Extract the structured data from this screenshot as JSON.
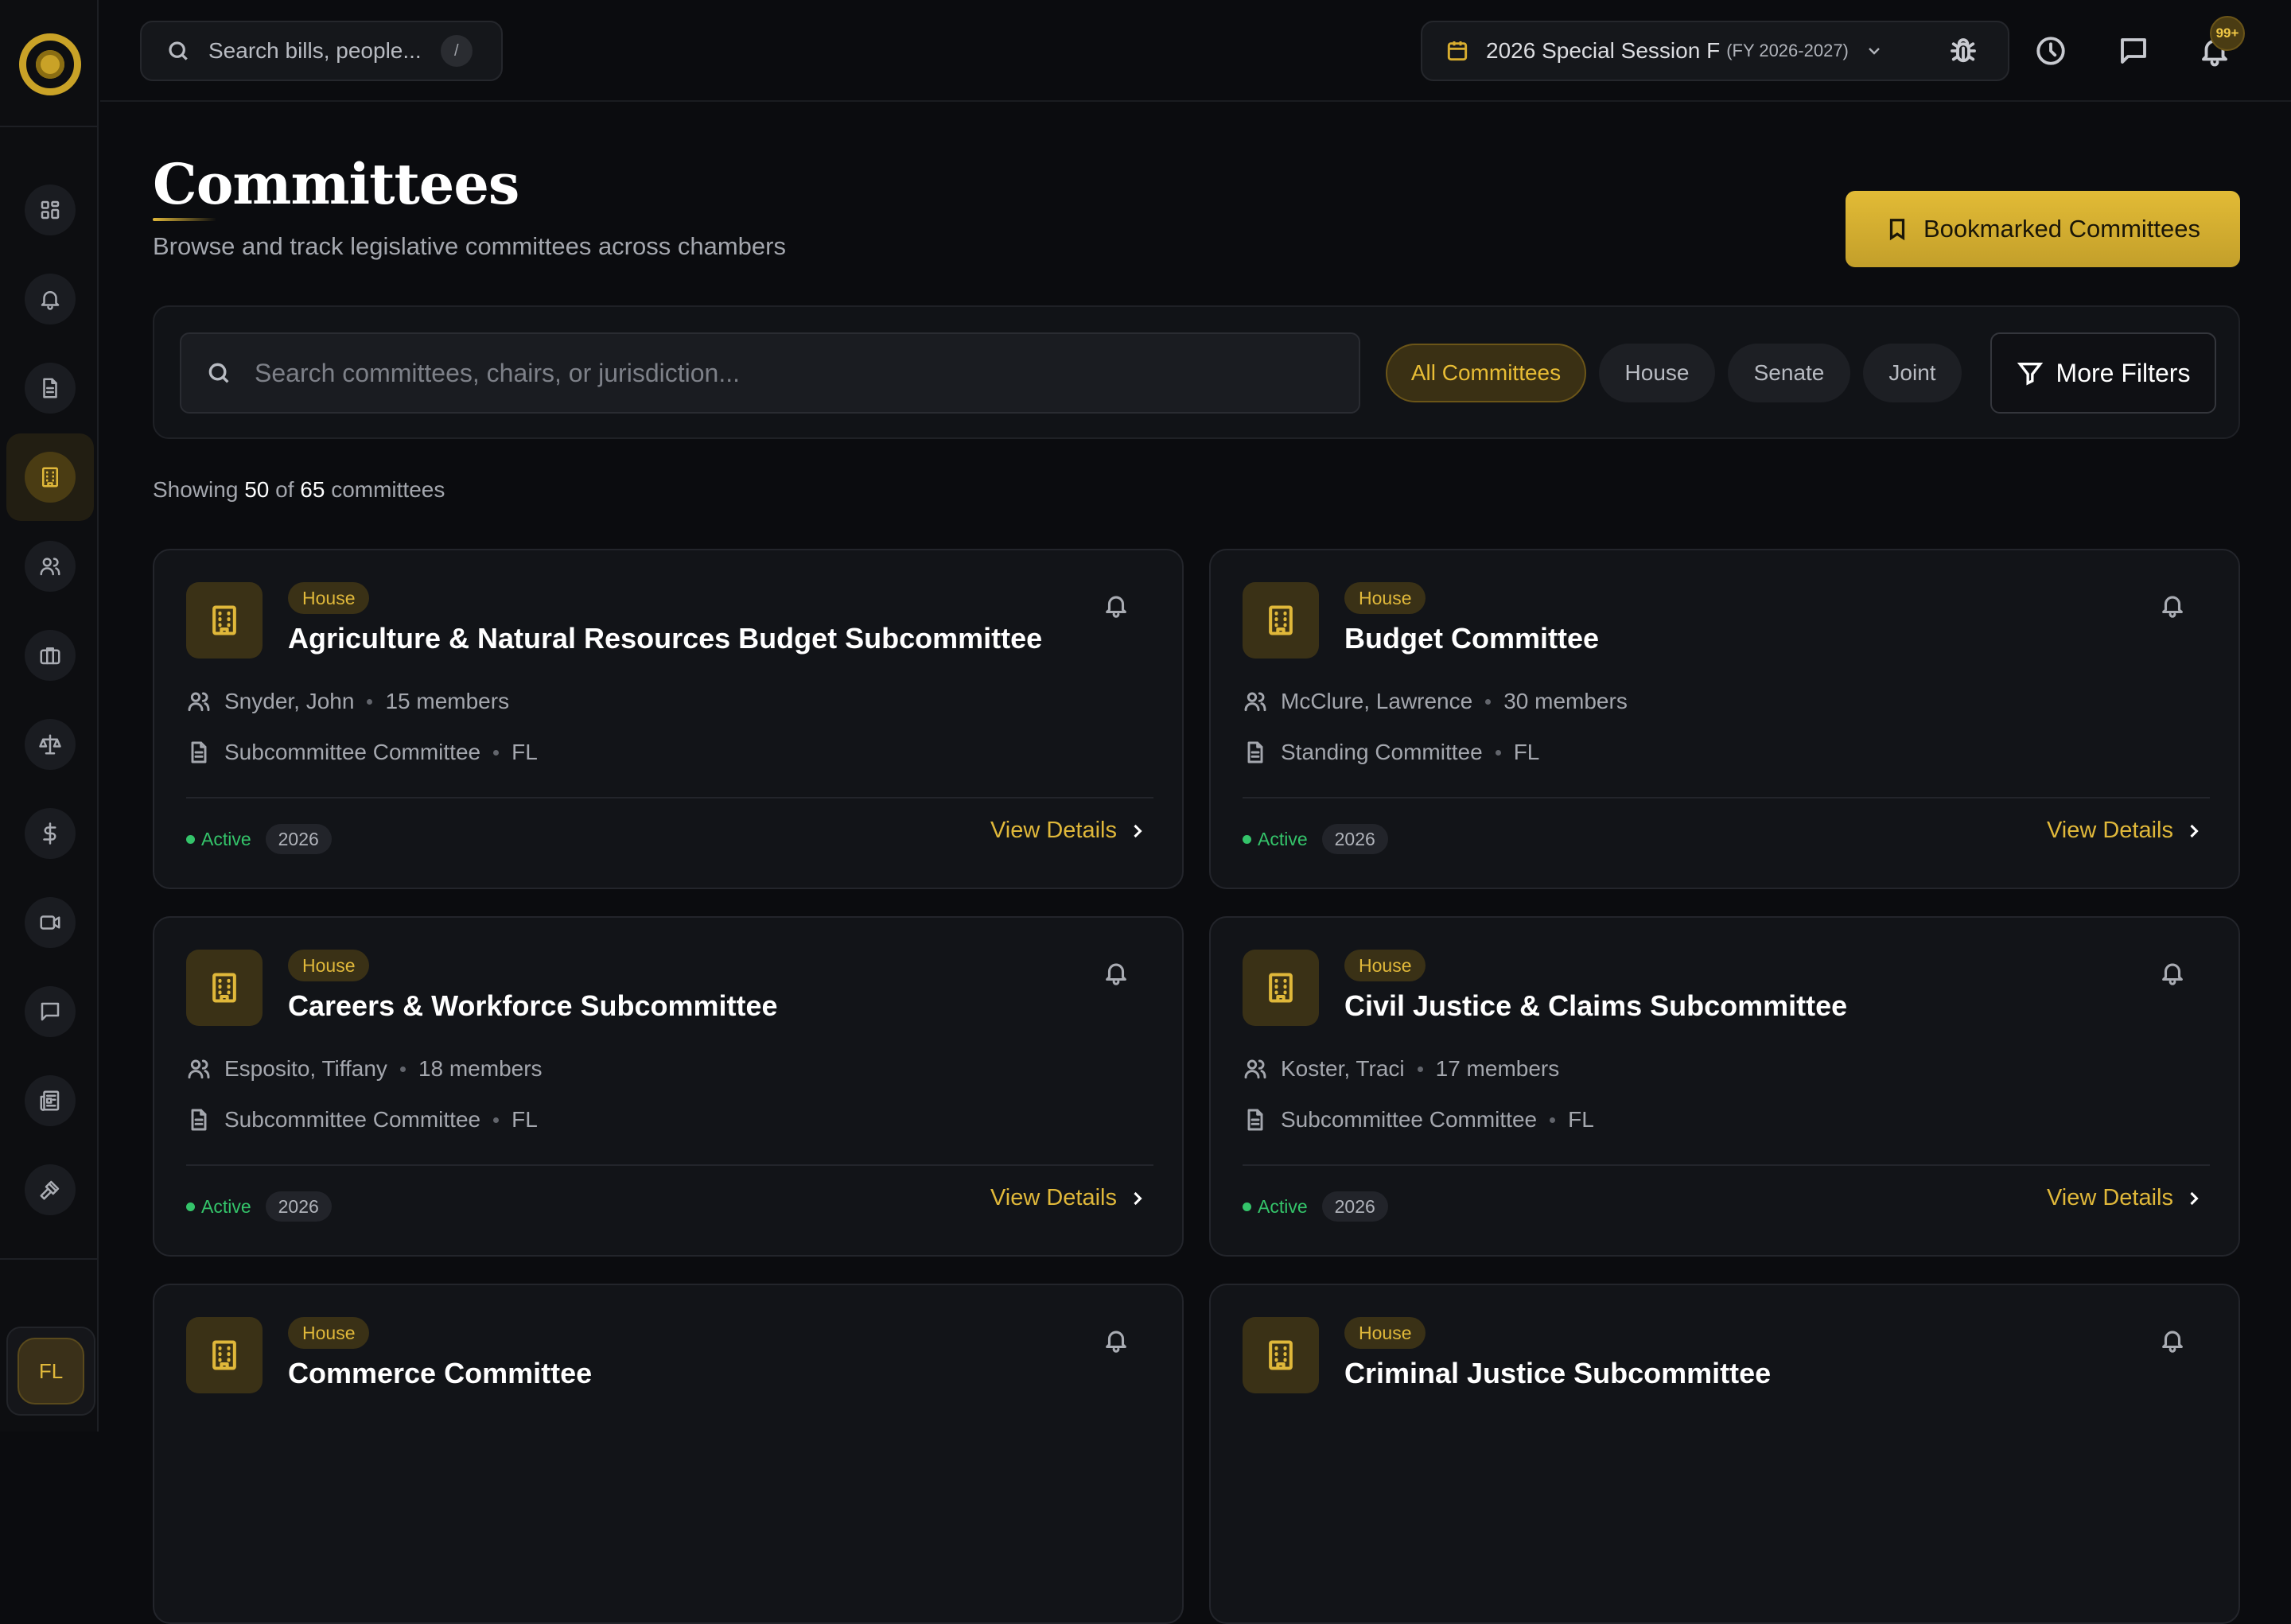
{
  "top_search": {
    "placeholder": "Search bills, people...",
    "shortcut": "/"
  },
  "session": {
    "label": "2026 Special Session F",
    "fy": "(FY 2026-2027)"
  },
  "notifications": {
    "count": "99+"
  },
  "sidebar": {
    "items": [
      {
        "icon": "dashboard-icon"
      },
      {
        "icon": "bell-icon"
      },
      {
        "icon": "document-icon"
      },
      {
        "icon": "building-icon",
        "active": true
      },
      {
        "icon": "people-icon"
      },
      {
        "icon": "briefcase-icon"
      },
      {
        "icon": "scale-icon"
      },
      {
        "icon": "dollar-icon"
      },
      {
        "icon": "video-icon"
      },
      {
        "icon": "chat-icon"
      },
      {
        "icon": "newspaper-icon"
      },
      {
        "icon": "gavel-icon"
      }
    ],
    "user_initials": "FL"
  },
  "header": {
    "title": "Committees",
    "subtitle": "Browse and track legislative committees across chambers",
    "bookmark_label": "Bookmarked Committees"
  },
  "filters": {
    "search_placeholder": "Search committees, chairs, or jurisdiction...",
    "chips": [
      "All Committees",
      "House",
      "Senate",
      "Joint"
    ],
    "active_chip": "All Committees",
    "more_label": "More Filters"
  },
  "summary": {
    "prefix": "Showing",
    "shown": "50",
    "of": "of",
    "total": "65",
    "suffix": "committees"
  },
  "colors": {
    "accent": "#e0b83a",
    "active_green": "#34c46a",
    "background": "#0b0c0f"
  },
  "committees": [
    {
      "chamber": "House",
      "name": "Agriculture & Natural Resources Budget Subcommittee",
      "chair": "Snyder, John",
      "members": "15 members",
      "type": "Subcommittee Committee",
      "state": "FL",
      "status": "Active",
      "year": "2026",
      "view": "View Details"
    },
    {
      "chamber": "House",
      "name": "Budget Committee",
      "chair": "McClure, Lawrence",
      "members": "30 members",
      "type": "Standing Committee",
      "state": "FL",
      "status": "Active",
      "year": "2026",
      "view": "View Details"
    },
    {
      "chamber": "House",
      "name": "Careers & Workforce Subcommittee",
      "chair": "Esposito, Tiffany",
      "members": "18 members",
      "type": "Subcommittee Committee",
      "state": "FL",
      "status": "Active",
      "year": "2026",
      "view": "View Details"
    },
    {
      "chamber": "House",
      "name": "Civil Justice & Claims Subcommittee",
      "chair": "Koster, Traci",
      "members": "17 members",
      "type": "Subcommittee Committee",
      "state": "FL",
      "status": "Active",
      "year": "2026",
      "view": "View Details"
    },
    {
      "chamber": "House",
      "name": "Commerce Committee",
      "chair": "",
      "members": "",
      "type": "",
      "state": "",
      "status": "",
      "year": "",
      "view": ""
    },
    {
      "chamber": "House",
      "name": "Criminal Justice Subcommittee",
      "chair": "",
      "members": "",
      "type": "",
      "state": "",
      "status": "",
      "year": "",
      "view": ""
    }
  ]
}
